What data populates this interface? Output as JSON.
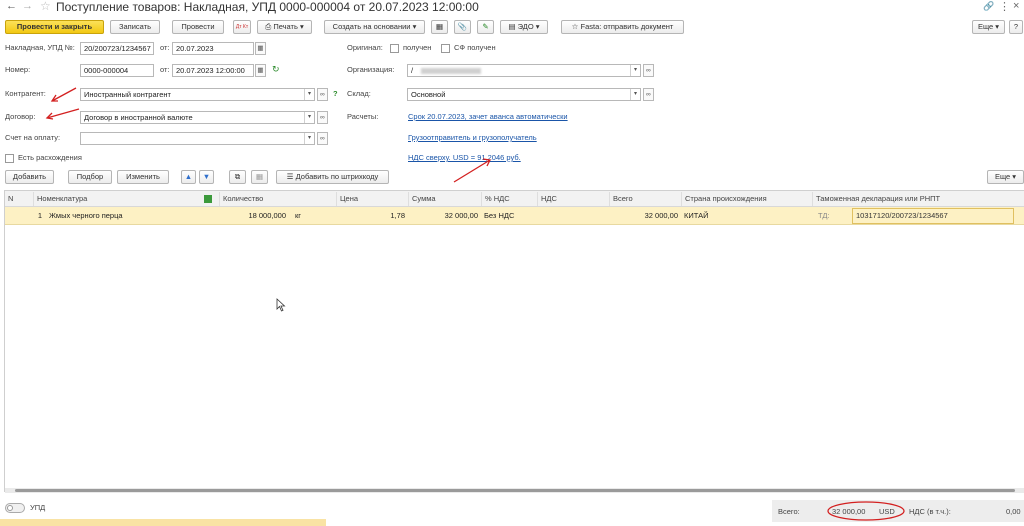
{
  "window": {
    "title": "Поступление товаров: Накладная, УПД 0000-000004 от 20.07.2023 12:00:00"
  },
  "toolbar": {
    "post_close": "Провести и закрыть",
    "write": "Записать",
    "post": "Провести",
    "print": "Печать",
    "create_based": "Создать на основании",
    "edo": "ЭДО",
    "fasta": "Fasta: отправить документ",
    "more": "Еще",
    "help": "?"
  },
  "form": {
    "invoice_label": "Накладная, УПД №:",
    "invoice_value": "20/200723/1234567",
    "from_label": "от:",
    "invoice_date": "20.07.2023",
    "number_label": "Номер:",
    "number_value": "0000-000004",
    "number_date": "20.07.2023 12:00:00",
    "original_label": "Оригинал:",
    "received_label": "получен",
    "sf_received_label": "СФ получен",
    "org_label": "Организация:",
    "org_value": "/",
    "counterparty_label": "Контрагент:",
    "counterparty_value": "Иностранный контрагент",
    "warehouse_label": "Склад:",
    "warehouse_value": "Основной",
    "contract_label": "Договор:",
    "contract_value": "Договор в иностранной валюте",
    "settlements_label": "Расчеты:",
    "settlements_link": "Срок 20.07.2023, зачет аванса автоматически",
    "shipper_link": "Грузоотправитель и грузополучатель",
    "payment_invoice_label": "Счет на оплату:",
    "payment_invoice_value": "",
    "vat_link": "НДС сверху. USD = 91,2046 руб.",
    "discrepancies_label": "Есть расхождения"
  },
  "table_toolbar": {
    "add": "Добавить",
    "pick": "Подбор",
    "change": "Изменить",
    "barcode": "Добавить по штрихкоду",
    "more": "Еще"
  },
  "table": {
    "columns": [
      "N",
      "Номенклатура",
      "Количество",
      "Цена",
      "Сумма",
      "% НДС",
      "НДС",
      "Всего",
      "Страна происхождения",
      "Таможенная декларация или РНПТ"
    ],
    "rows": [
      {
        "n": "1",
        "item": "Жмых черного перца",
        "qty": "18 000,000",
        "unit": "кг",
        "price": "1,78",
        "sum": "32 000,00",
        "vat_rate": "Без НДС",
        "vat": "",
        "total": "32 000,00",
        "country": "КИТАЙ",
        "td_label": "ТД:",
        "declaration": "10317120/200723/1234567"
      }
    ]
  },
  "footer": {
    "upd_label": "УПД",
    "total_label": "Всего:",
    "total_value": "32 000,00",
    "currency": "USD",
    "vat_label": "НДС (в т.ч.):",
    "vat_value": "0,00"
  }
}
